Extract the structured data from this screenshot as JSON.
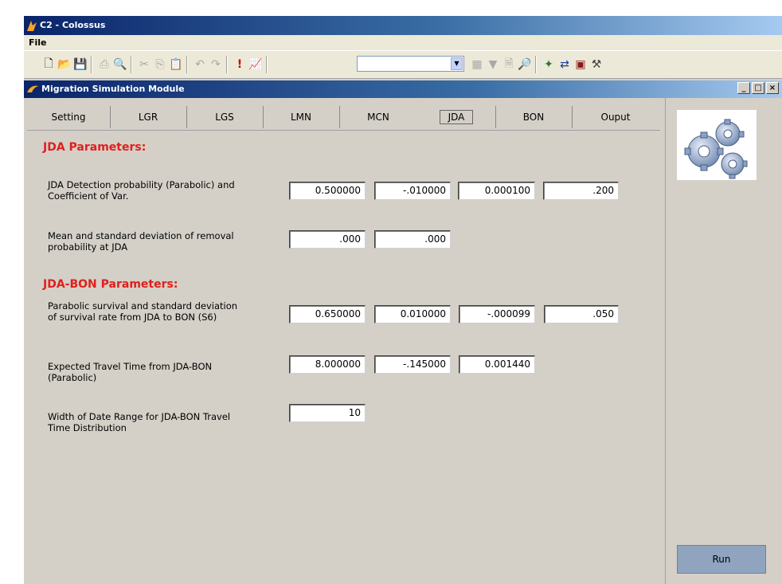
{
  "app": {
    "title": "C2 - Colossus"
  },
  "menu": {
    "file": "File"
  },
  "toolbar": {
    "combo_value": ""
  },
  "module": {
    "title": "Migration Simulation Module",
    "min": "_",
    "max": "□",
    "close": "×"
  },
  "tabs": [
    "Setting",
    "LGR",
    "LGS",
    "LMN",
    "MCN",
    "JDA",
    "BON",
    "Ouput"
  ],
  "active_tab": "JDA",
  "jda": {
    "heading": "JDA Parameters:",
    "rows": [
      {
        "label": "JDA Detection probability (Parabolic) and Coefficient of Var.",
        "values": [
          "0.500000",
          "-.010000",
          "0.000100",
          ".200"
        ]
      },
      {
        "label": "Mean and standard deviation of removal probability at JDA",
        "values": [
          ".000",
          ".000"
        ]
      }
    ]
  },
  "jda_bon": {
    "heading": "JDA-BON Parameters:",
    "rows": [
      {
        "label": "Parabolic survival and standard deviation of survival rate from JDA to BON (S6)",
        "values": [
          "0.650000",
          "0.010000",
          "-.000099",
          ".050"
        ]
      },
      {
        "label": "Expected Travel Time from JDA-BON (Parabolic)",
        "values": [
          "8.000000",
          "-.145000",
          "0.001440"
        ]
      },
      {
        "label": "Width of Date Range for JDA-BON Travel Time Distribution",
        "values": [
          "10"
        ]
      }
    ]
  },
  "run_button": "Run",
  "colors": {
    "heading": "#e0201c",
    "titlebar": "#0a246a",
    "run": "#90a4c0"
  }
}
